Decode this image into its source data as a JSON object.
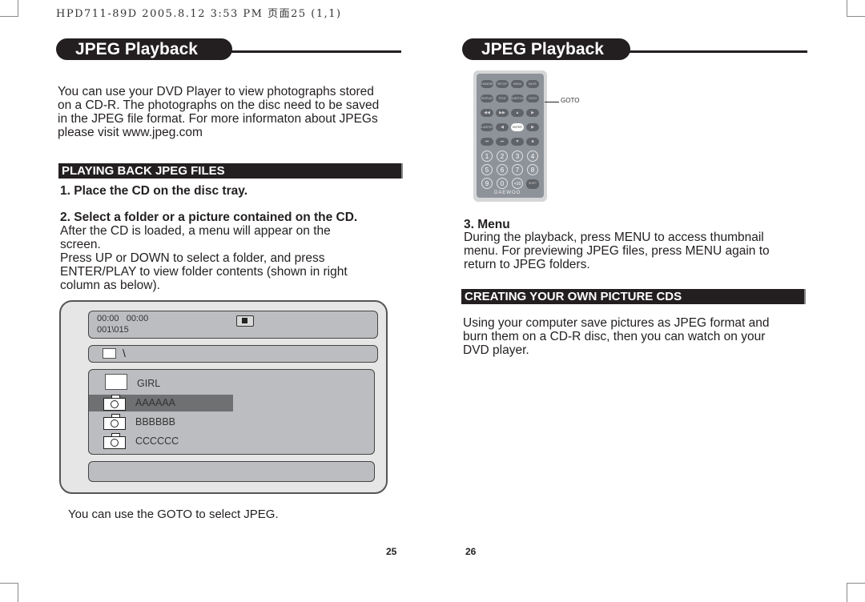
{
  "print_header": "HPD711-89D  2005.8.12  3:53 PM  页面25 (1,1)",
  "left_page": {
    "title": "JPEG Playback",
    "intro_lines": [
      "You can use your DVD Player to view photographs stored",
      "on a CD-R. The photographs on the disc need to be saved",
      "in the JPEG file format. For more informaton about JPEGs",
      "please visit www.jpeg.com"
    ],
    "section_heading": "PLAYING BACK JPEG FILES",
    "step1": "1. Place the CD on the disc tray.",
    "step2_title": "2. Select a folder or a picture contained on the CD.",
    "step2_lines": [
      "After the CD is loaded, a menu will appear on the",
      "screen.",
      "Press UP or DOWN to select a folder, and press",
      "ENTER/PLAY to view folder contents (shown in right",
      "column as below)."
    ],
    "screen": {
      "time": "00:00   00:00",
      "track": "001\\015",
      "stop_icon": "stop-icon",
      "path": "\\",
      "items": [
        {
          "type": "folder",
          "label": "GIRL",
          "selected": false
        },
        {
          "type": "picture",
          "label": "AAAAAA",
          "selected": true
        },
        {
          "type": "picture",
          "label": "BBBBBB",
          "selected": false
        },
        {
          "type": "picture",
          "label": "CCCCCC",
          "selected": false
        }
      ]
    },
    "footer_note": "You can use the GOTO to select JPEG.",
    "page_number": "25"
  },
  "right_page": {
    "title": "JPEG Playback",
    "remote": {
      "callout": "GOTO",
      "row1": [
        "STANDBY",
        "SETUP",
        "MENU",
        "MUTE"
      ],
      "row2": [
        "DISPLAY",
        "TITLE",
        "SUBTITLE",
        "GOTO"
      ],
      "row3": [
        "◀◀",
        "▶▶",
        "▲",
        "▶"
      ],
      "row4": [
        "A-B/STEP",
        "◀",
        "ENTER",
        "▶"
      ],
      "row5": [
        "⏮",
        "⏭",
        "▼",
        "■"
      ],
      "numbers": [
        "1",
        "2",
        "3",
        "4",
        "5",
        "6",
        "7",
        "8",
        "9",
        "0",
        "+10"
      ],
      "shift": "SHIFT",
      "brand": "DAEWOO"
    },
    "step3_title": "3. Menu",
    "step3_lines": [
      "During the playback, press MENU to access thumbnail",
      "menu. For previewing JPEG files, press MENU again to",
      "return to JPEG folders."
    ],
    "section_heading": "CREATING YOUR OWN PICTURE CDS",
    "creating_lines": [
      "Using your computer save pictures as JPEG format and",
      "burn them on a CD-R disc, then you can watch on your",
      "DVD player."
    ],
    "page_number": "26"
  }
}
